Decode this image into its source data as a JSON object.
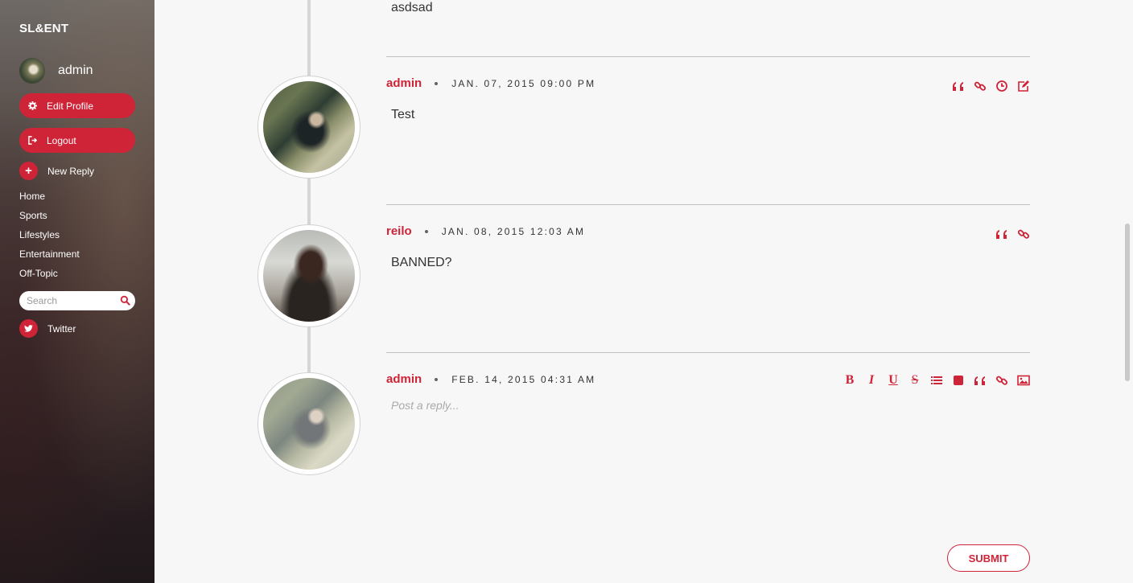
{
  "sidebar": {
    "brand": "SL&ENT",
    "user_name": "admin",
    "edit_profile": "Edit Profile",
    "logout": "Logout",
    "new_reply": "New Reply",
    "nav": [
      "Home",
      "Sports",
      "Lifestyles",
      "Entertainment",
      "Off-Topic"
    ],
    "search_placeholder": "Search",
    "twitter": "Twitter"
  },
  "thread": {
    "posts": [
      {
        "text": "asdsad"
      },
      {
        "author": "admin",
        "date": "JAN. 07, 2015 09:00 PM",
        "text": "Test",
        "actions": [
          "quote-icon",
          "link-icon",
          "clock-icon",
          "edit-icon"
        ]
      },
      {
        "author": "reilo",
        "date": "JAN. 08, 2015 12:03 AM",
        "text": "BANNED?",
        "actions": [
          "quote-icon",
          "link-icon"
        ]
      }
    ],
    "reply": {
      "author": "admin",
      "date": "FEB. 14, 2015 04:31 AM",
      "placeholder": "Post a reply...",
      "toolbar": [
        "bold-icon",
        "italic-icon",
        "underline-icon",
        "strikethrough-icon",
        "list-icon",
        "spoiler-icon",
        "quote-icon",
        "link-icon",
        "image-icon"
      ],
      "bold_glyph": "B",
      "italic_glyph": "I",
      "underline_glyph": "U",
      "strike_glyph": "S",
      "submit": "SUBMIT"
    }
  },
  "colors": {
    "accent": "#cf2337",
    "background": "#f7f7f7",
    "divider": "#bdbdbd"
  }
}
